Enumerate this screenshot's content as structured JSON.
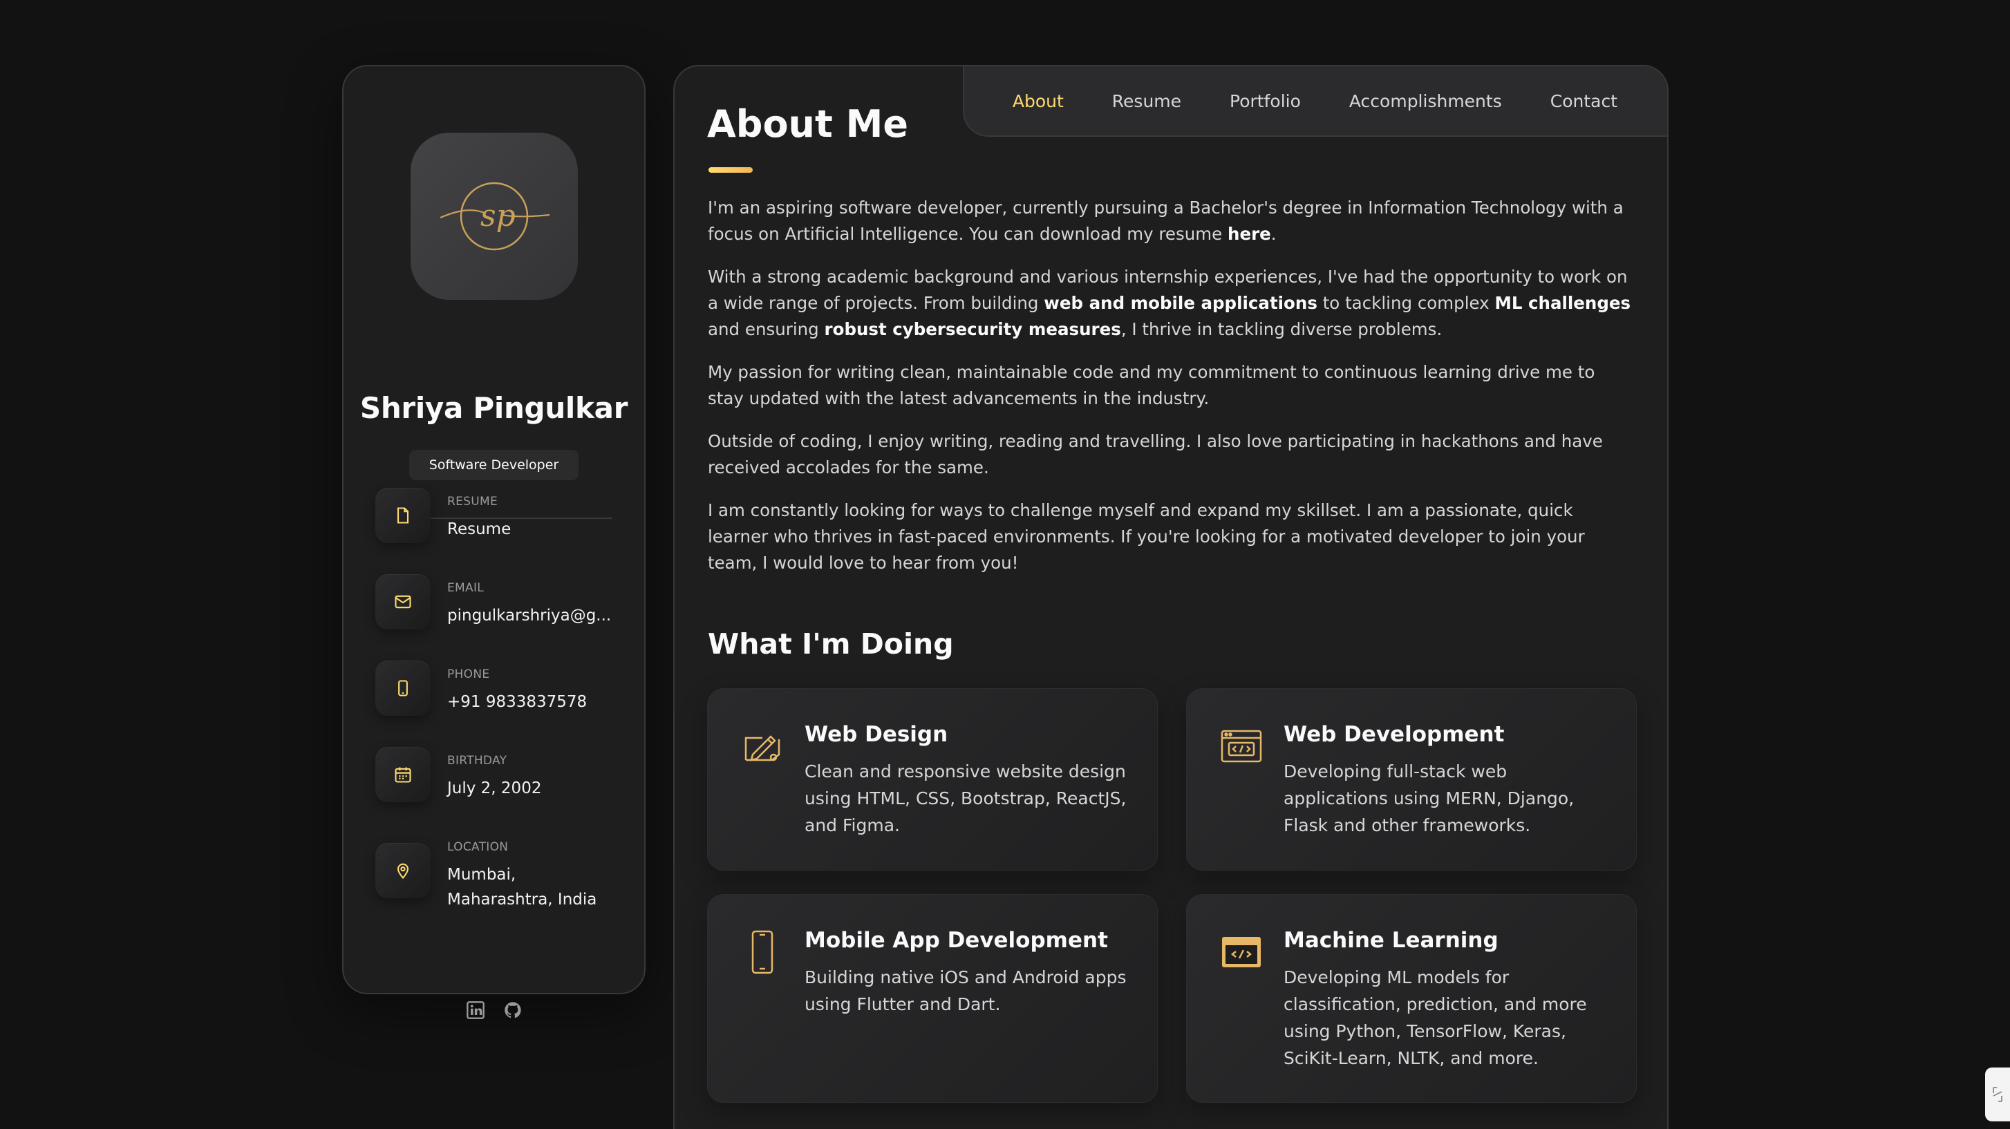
{
  "profile": {
    "name": "Shriya Pingulkar",
    "title": "Software Developer",
    "avatar_icon": "signature-sp-logo"
  },
  "contacts": [
    {
      "icon": "file-icon",
      "label": "RESUME",
      "value": "Resume"
    },
    {
      "icon": "mail-icon",
      "label": "EMAIL",
      "value": "pingulkarshriya@g..."
    },
    {
      "icon": "phone-icon",
      "label": "PHONE",
      "value": "+91 9833837578"
    },
    {
      "icon": "calendar-icon",
      "label": "BIRTHDAY",
      "value": "July 2, 2002"
    },
    {
      "icon": "location-pin-icon",
      "label": "LOCATION",
      "value_line1": "Mumbai,",
      "value_line2": "Maharashtra, India"
    }
  ],
  "socials": [
    "linkedin-icon",
    "github-icon"
  ],
  "nav": {
    "items": [
      "About",
      "Resume",
      "Portfolio",
      "Accomplishments",
      "Contact"
    ],
    "active": "About"
  },
  "about": {
    "title": "About Me",
    "p1_a": "I'm an aspiring software developer, currently pursuing a Bachelor's degree in Information Technology with a focus on Artificial Intelligence. You can download my resume ",
    "p1_link": "here",
    "p1_b": ".",
    "p2_a": "With a strong academic background and various internship experiences, I've had the opportunity to work on a wide range of projects. From building ",
    "p2_b1": "web and mobile applications",
    "p2_b": " to tackling complex ",
    "p2_b2": "ML challenges",
    "p2_c": " and ensuring ",
    "p2_b3": "robust cybersecurity measures",
    "p2_d": ", I thrive in tackling diverse problems.",
    "p3": "My passion for writing clean, maintainable code and my commitment to continuous learning drive me to stay updated with the latest advancements in the industry.",
    "p4": "Outside of coding, I enjoy writing, reading and travelling. I also love participating in hackathons and have received accolades for the same.",
    "p5": "I am constantly looking for ways to challenge myself and expand my skillset. I am a passionate, quick learner who thrives in fast-paced environments. If you're looking for a motivated developer to join your team, I would love to hear from you!"
  },
  "services": {
    "title": "What I'm Doing",
    "items": [
      {
        "icon": "design-pencil-icon",
        "title": "Web Design",
        "text": "Clean and responsive website design using HTML, CSS, Bootstrap, ReactJS, and Figma."
      },
      {
        "icon": "code-window-icon",
        "title": "Web Development",
        "text": "Developing full-stack web applications using MERN, Django, Flask and other frameworks."
      },
      {
        "icon": "mobile-phone-icon",
        "title": "Mobile App Development",
        "text": "Building native iOS and Android apps using Flutter and Dart."
      },
      {
        "icon": "code-monitor-icon",
        "title": "Machine Learning",
        "text": "Developing ML models for classification, prediction, and more using Python, TensorFlow, Keras, SciKit-Learn, NLTK, and more."
      }
    ]
  },
  "colors": {
    "accent": "#ffdb70",
    "background": "#121212",
    "card": "#1e1e1f",
    "border": "#383838"
  }
}
